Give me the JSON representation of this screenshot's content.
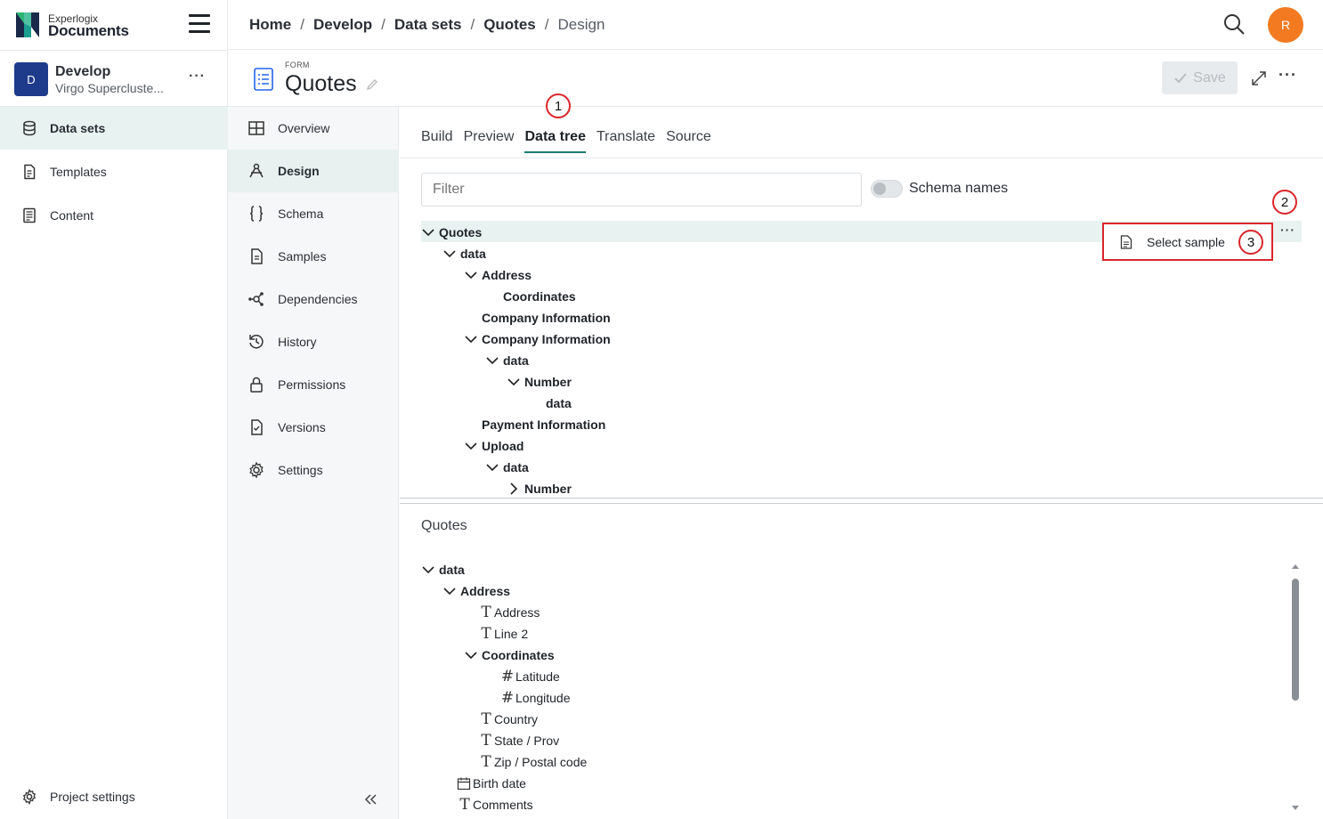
{
  "app": {
    "brand_small": "Experlogix",
    "brand_big": "Documents",
    "avatar_initial": "R",
    "accent_color": "#1a7a6d",
    "avatar_color": "#f37a21"
  },
  "project": {
    "badge": "D",
    "name": "Develop",
    "subtitle": "Virgo Superclust e...",
    "more": "···"
  },
  "sidebar": {
    "items": [
      {
        "label": "Data sets",
        "icon": "database-icon",
        "active": true
      },
      {
        "label": "Templates",
        "icon": "template-icon",
        "active": false
      },
      {
        "label": "Content",
        "icon": "content-icon",
        "active": false
      }
    ],
    "footer": "Project settings"
  },
  "breadcrumb": [
    "Home",
    "Develop",
    "Data sets",
    "Quotes",
    "Design"
  ],
  "form": {
    "label": "FORM",
    "title": "Quotes",
    "save_label": "Save"
  },
  "subnav": {
    "items": [
      {
        "label": "Overview",
        "icon": "grid-icon",
        "active": false
      },
      {
        "label": "Design",
        "icon": "design-icon",
        "active": true
      },
      {
        "label": "Schema",
        "icon": "braces-icon",
        "active": false
      },
      {
        "label": "Samples",
        "icon": "document-icon",
        "active": false
      },
      {
        "label": "Dependencies",
        "icon": "network-icon",
        "active": false
      },
      {
        "label": "History",
        "icon": "history-icon",
        "active": false
      },
      {
        "label": "Permissions",
        "icon": "lock-icon",
        "active": false
      },
      {
        "label": "Versions",
        "icon": "file-check-icon",
        "active": false
      },
      {
        "label": "Settings",
        "icon": "gear-icon",
        "active": false
      }
    ]
  },
  "tabs": [
    "Build",
    "Preview",
    "Data tree",
    "Translate",
    "Source"
  ],
  "active_tab": "Data tree",
  "filter": {
    "placeholder": "Filter",
    "value": ""
  },
  "schema_toggle": {
    "label": "Schema names",
    "on": false
  },
  "tree": [
    {
      "label": "Quotes",
      "level": 0,
      "expand": "open"
    },
    {
      "label": "data",
      "level": 1,
      "expand": "open"
    },
    {
      "label": "Address",
      "level": 2,
      "expand": "open"
    },
    {
      "label": "Coordinates",
      "level": 3,
      "expand": "none"
    },
    {
      "label": "Company Information",
      "level": 2,
      "expand": "none"
    },
    {
      "label": "Company Information",
      "level": 2,
      "expand": "open"
    },
    {
      "label": "data",
      "level": 3,
      "expand": "open"
    },
    {
      "label": "Number",
      "level": 4,
      "expand": "open"
    },
    {
      "label": "data",
      "level": 5,
      "expand": "none"
    },
    {
      "label": "Payment Information",
      "level": 2,
      "expand": "none"
    },
    {
      "label": "Upload",
      "level": 2,
      "expand": "open"
    },
    {
      "label": "data",
      "level": 3,
      "expand": "open"
    },
    {
      "label": "Number",
      "level": 4,
      "expand": "closed"
    }
  ],
  "context_menu": {
    "item": "Select sample"
  },
  "callouts": [
    "1",
    "2",
    "3"
  ],
  "lower": {
    "title": "Quotes",
    "rows": [
      {
        "label": "data",
        "level": 0,
        "kind": "open"
      },
      {
        "label": "Address",
        "level": 1,
        "kind": "open"
      },
      {
        "label": "Address",
        "level": 2,
        "kind": "text"
      },
      {
        "label": "Line 2",
        "level": 2,
        "kind": "text"
      },
      {
        "label": "Coordinates",
        "level": 2,
        "kind": "open"
      },
      {
        "label": "Latitude",
        "level": 3,
        "kind": "number"
      },
      {
        "label": "Longitude",
        "level": 3,
        "kind": "number"
      },
      {
        "label": "Country",
        "level": 2,
        "kind": "text"
      },
      {
        "label": "State / Prov",
        "level": 2,
        "kind": "text"
      },
      {
        "label": "Zip / Postal code",
        "level": 2,
        "kind": "text"
      },
      {
        "label": "Birth date",
        "level": 1,
        "kind": "date"
      },
      {
        "label": "Comments",
        "level": 1,
        "kind": "text"
      }
    ]
  }
}
